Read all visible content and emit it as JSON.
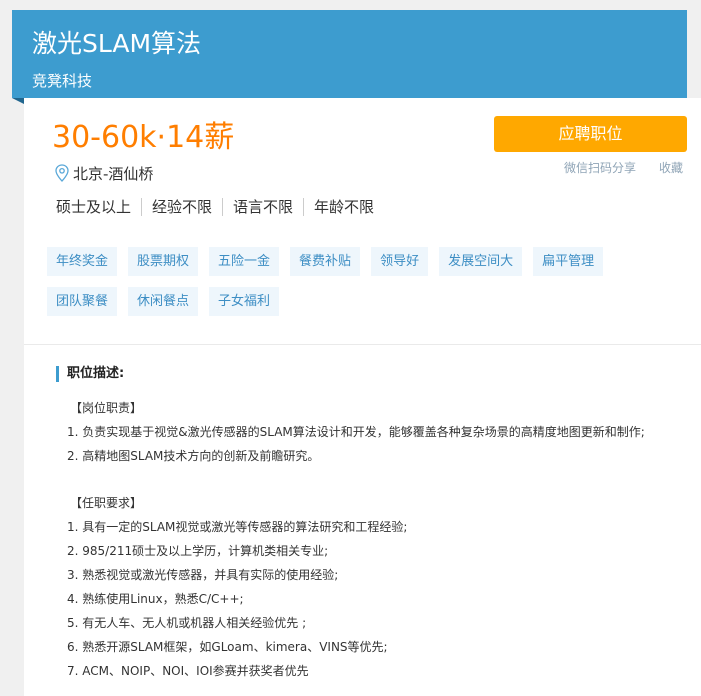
{
  "header": {
    "job_title": "激光SLAM算法",
    "company": "竞凳科技",
    "banner_color": "#3d9ccf"
  },
  "summary": {
    "salary": "30-60k·14薪",
    "salary_color": "#ff7e00",
    "apply_label": "应聘职位",
    "apply_color": "#ffa800",
    "share_label": "微信扫码分享",
    "favorite_label": "收藏",
    "location": "北京-酒仙桥",
    "location_icon": "map-pin-icon",
    "requirements": [
      "硕士及以上",
      "经验不限",
      "语言不限",
      "年龄不限"
    ]
  },
  "tags": [
    "年终奖金",
    "股票期权",
    "五险一金",
    "餐费补贴",
    "领导好",
    "发展空间大",
    "扁平管理",
    "团队聚餐",
    "休闲餐点",
    "子女福利"
  ],
  "description": {
    "heading": "职位描述:",
    "duties_title": "【岗位职责】",
    "duties": [
      "1. 负责实现基于视觉&激光传感器的SLAM算法设计和开发，能够覆盖各种复杂场景的高精度地图更新和制作;",
      "2. 高精地图SLAM技术方向的创新及前瞻研究。"
    ],
    "reqs_title": "【任职要求】",
    "reqs": [
      "1. 具有一定的SLAM视觉或激光等传感器的算法研究和工程经验;",
      "2. 985/211硕士及以上学历，计算机类相关专业;",
      "3. 熟悉视觉或激光传感器，并具有实际的使用经验;",
      "4. 熟练使用Linux，熟悉C/C++;",
      "5. 有无人车、无人机或机器人相关经验优先 ;",
      "6. 熟悉开源SLAM框架，如GLoam、kimera、VINS等优先;",
      "7. ACM、NOIP、NOI、IOI参赛并获奖者优先"
    ]
  }
}
